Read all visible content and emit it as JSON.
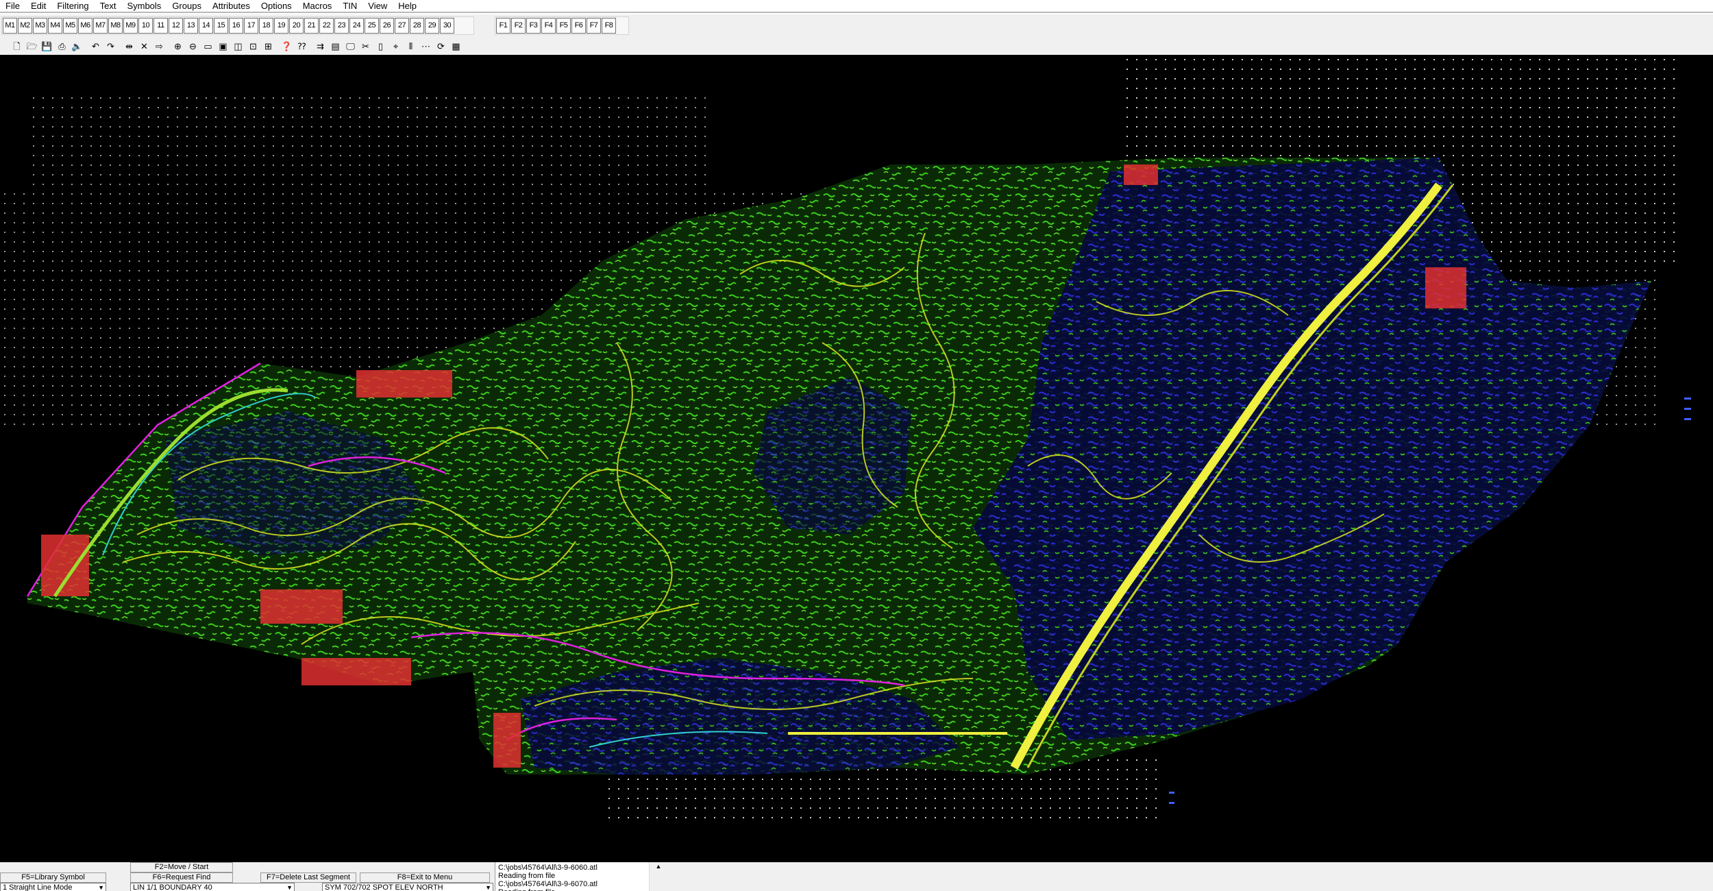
{
  "menu": [
    "File",
    "Edit",
    "Filtering",
    "Text",
    "Symbols",
    "Groups",
    "Attributes",
    "Options",
    "Macros",
    "TIN",
    "View",
    "Help"
  ],
  "macro_keys": [
    "M1",
    "M2",
    "M3",
    "M4",
    "M5",
    "M6",
    "M7",
    "M8",
    "M9",
    "10",
    "11",
    "12",
    "13",
    "14",
    "15",
    "16",
    "17",
    "18",
    "19",
    "20",
    "21",
    "22",
    "23",
    "24",
    "25",
    "26",
    "27",
    "28",
    "29",
    "30"
  ],
  "function_keys": [
    "F1",
    "F2",
    "F3",
    "F4",
    "F5",
    "F6",
    "F7",
    "F8"
  ],
  "toolbar_icons": [
    {
      "name": "new-file-icon",
      "glyph": "🗋"
    },
    {
      "name": "open-folder-icon",
      "glyph": "🗁"
    },
    {
      "name": "save-icon",
      "glyph": "💾"
    },
    {
      "name": "print-icon",
      "glyph": "⎙"
    },
    {
      "name": "speaker-icon",
      "glyph": "🔈"
    },
    {
      "name": "sep"
    },
    {
      "name": "undo-icon",
      "glyph": "↶"
    },
    {
      "name": "redo-icon",
      "glyph": "↷"
    },
    {
      "name": "sep"
    },
    {
      "name": "measure-icon",
      "glyph": "⇹"
    },
    {
      "name": "delete-segment-icon",
      "glyph": "✕"
    },
    {
      "name": "move-right-icon",
      "glyph": "⇨"
    },
    {
      "name": "sep"
    },
    {
      "name": "zoom-in-icon",
      "glyph": "⊕"
    },
    {
      "name": "zoom-out-icon",
      "glyph": "⊖"
    },
    {
      "name": "zoom-window-icon",
      "glyph": "▭"
    },
    {
      "name": "zoom-extent-icon",
      "glyph": "▣"
    },
    {
      "name": "zoom-previous-icon",
      "glyph": "◫"
    },
    {
      "name": "pan-icon",
      "glyph": "⊡"
    },
    {
      "name": "redraw-icon",
      "glyph": "⊞"
    },
    {
      "name": "sep"
    },
    {
      "name": "help-icon",
      "glyph": "❓"
    },
    {
      "name": "whats-this-icon",
      "glyph": "⁇"
    },
    {
      "name": "sep"
    },
    {
      "name": "import-icon",
      "glyph": "⇉"
    },
    {
      "name": "layer-icon",
      "glyph": "▤"
    },
    {
      "name": "monitor-icon",
      "glyph": "🖵"
    },
    {
      "name": "scissors-icon",
      "glyph": "✂"
    },
    {
      "name": "dimmed-tool-icon",
      "glyph": "▯"
    },
    {
      "name": "snap-icon",
      "glyph": "⌖"
    },
    {
      "name": "align-icon",
      "glyph": "⫴"
    },
    {
      "name": "grid-icon",
      "glyph": "⋯"
    },
    {
      "name": "refresh-icon",
      "glyph": "⟳"
    },
    {
      "name": "properties-icon",
      "glyph": "▦"
    }
  ],
  "status": {
    "f2": "F2=Move / Start",
    "f5": "F5=Library Symbol",
    "f6": "F6=Request Find",
    "f7": "F7=Delete Last Segment",
    "f8": "F8=Exit to Menu",
    "combo1": "1 Straight Line Mode",
    "combo2": "LIN 1/1 BOUNDARY 40",
    "combo3": "SYM 702/702 SPOT ELEV NORTH"
  },
  "log": [
    "C:\\jobs\\45764\\All\\3-9-6060.atl",
    "Reading from file",
    "C:\\jobs\\45764\\All\\3-9-6070.atl",
    "Reading from file"
  ],
  "colors": {
    "canvas": "#000000",
    "vegetation_green": "#3ccf1e",
    "vegetation_blue": "#2a2ad6",
    "contour_yellow": "#d8e820",
    "road_yellow": "#f0f040",
    "boundary_magenta": "#e020e0",
    "structure_red": "#e03030",
    "grid_dot": "#cfcfcf"
  }
}
